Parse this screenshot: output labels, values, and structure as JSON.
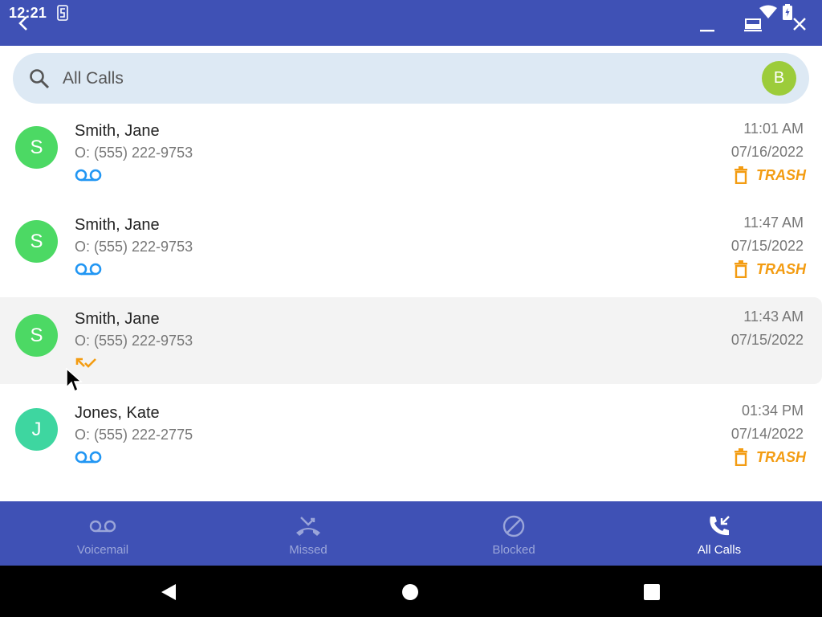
{
  "status_bar": {
    "time": "12:21"
  },
  "search": {
    "placeholder": "All Calls",
    "avatar_letter": "B"
  },
  "colors": {
    "primary": "#3f51b5",
    "accent_trash": "#f39c12",
    "voicemail_blue": "#2196f3",
    "avatar_green": "#4cd964",
    "avatar_teal": "#3ed6a0",
    "avatar_b": "#9ccc3a"
  },
  "calls": [
    {
      "letter": "S",
      "name": "Smith, Jane",
      "phone": "O: (555) 222-9753",
      "time": "11:01 AM",
      "date": "07/16/2022",
      "type": "voicemail-icon",
      "action": "TRASH"
    },
    {
      "letter": "S",
      "name": "Smith, Jane",
      "phone": "O: (555) 222-9753",
      "time": "11:47 AM",
      "date": "07/15/2022",
      "type": "voicemail-icon",
      "action": "TRASH"
    },
    {
      "letter": "S",
      "name": "Smith, Jane",
      "phone": "O: (555) 222-9753",
      "time": "11:43 AM",
      "date": "07/15/2022",
      "type": "incoming-call-icon",
      "action": ""
    },
    {
      "letter": "J",
      "name": "Jones, Kate",
      "phone": "O: (555) 222-2775",
      "time": "01:34 PM",
      "date": "07/14/2022",
      "type": "voicemail-icon",
      "action": "TRASH"
    }
  ],
  "tabs": [
    {
      "label": "Voicemail",
      "icon": "voicemail-icon"
    },
    {
      "label": "Missed",
      "icon": "missed-call-icon"
    },
    {
      "label": "Blocked",
      "icon": "blocked-icon"
    },
    {
      "label": "All Calls",
      "icon": "all-calls-icon",
      "active": true
    }
  ]
}
